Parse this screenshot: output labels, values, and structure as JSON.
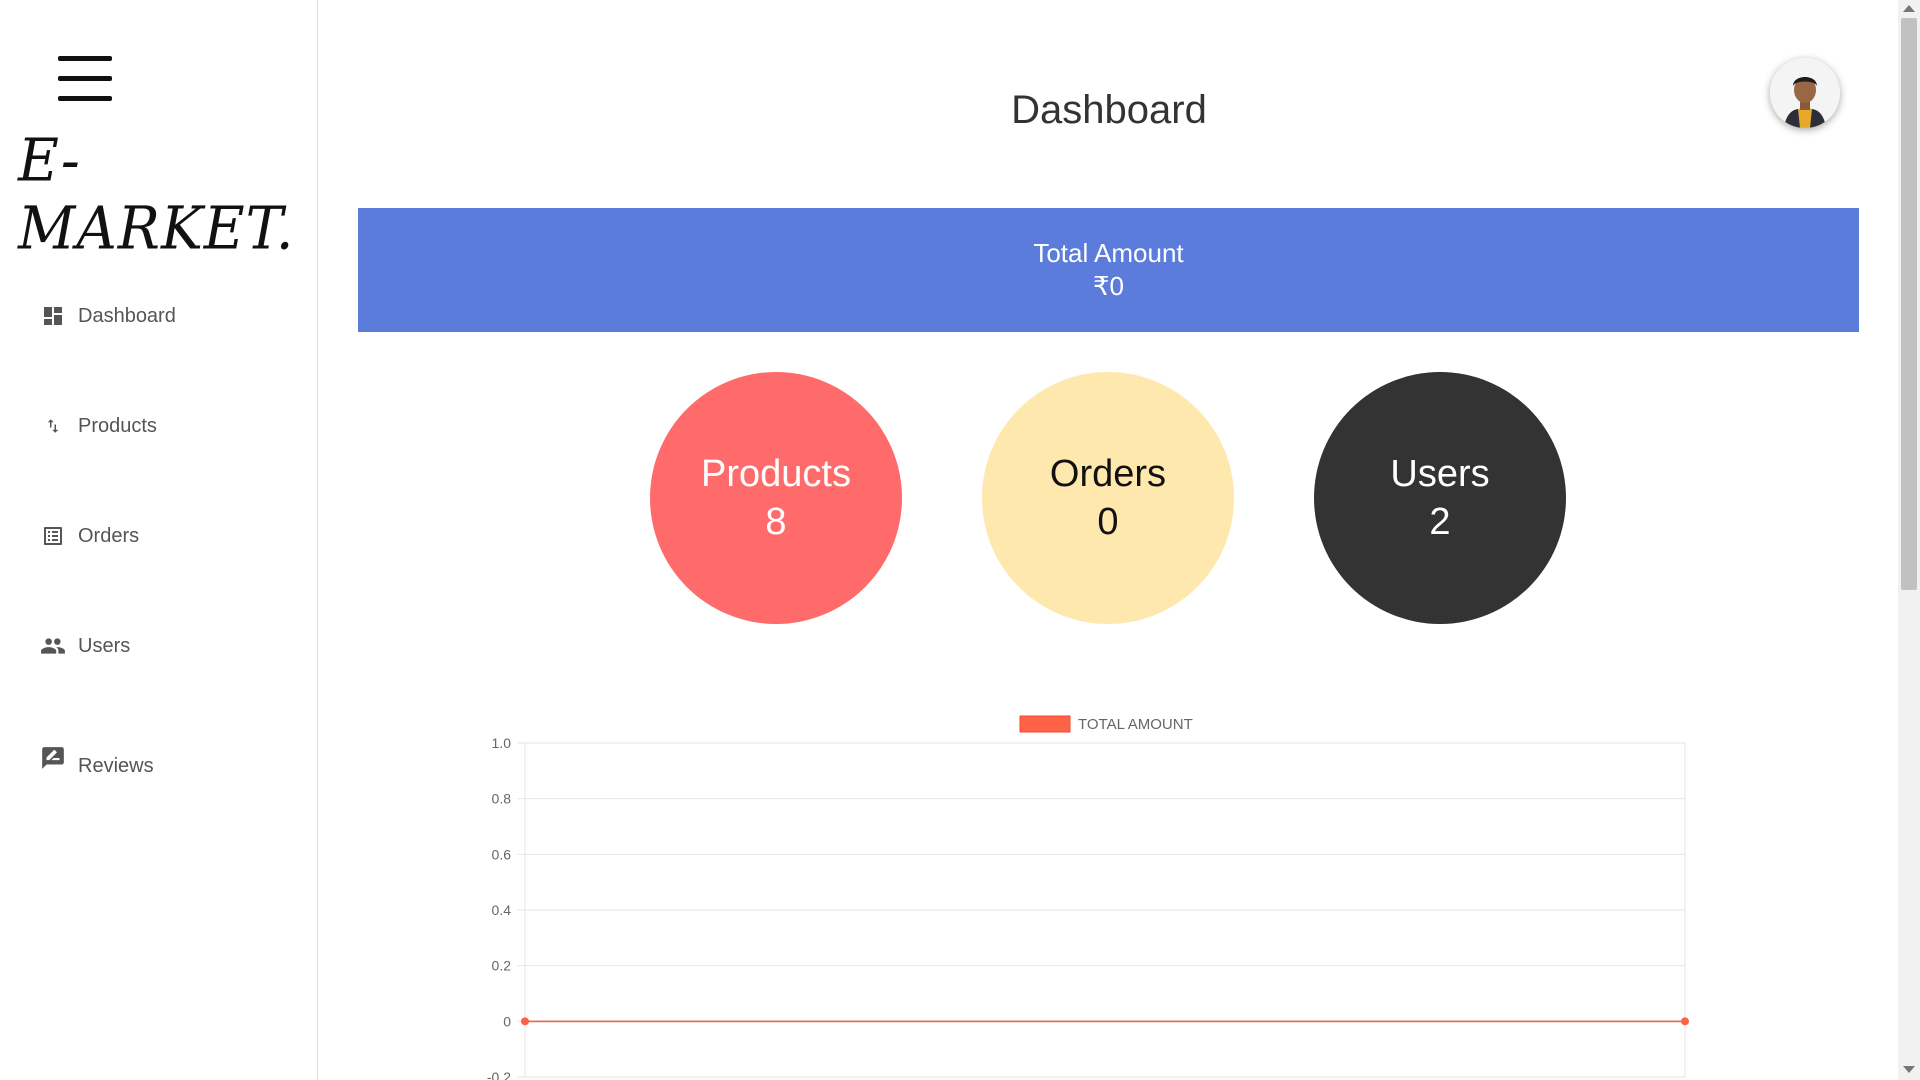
{
  "sidebar": {
    "logo": "E-MARKET.",
    "items": [
      {
        "label": "Dashboard",
        "icon": "dashboard-icon"
      },
      {
        "label": "Products",
        "icon": "swap-vert-icon"
      },
      {
        "label": "Orders",
        "icon": "list-alt-icon"
      },
      {
        "label": "Users",
        "icon": "people-icon"
      },
      {
        "label": "Reviews",
        "icon": "rate-review-icon"
      }
    ]
  },
  "header": {
    "title": "Dashboard"
  },
  "summary": {
    "total_label": "Total Amount",
    "total_value": "₹0"
  },
  "stats": [
    {
      "label": "Products",
      "value": "8",
      "color": "#ff6b6b"
    },
    {
      "label": "Orders",
      "value": "0",
      "color": "#ffe8ad"
    },
    {
      "label": "Users",
      "value": "2",
      "color": "#333333"
    }
  ],
  "colors": {
    "accent": "#5c7cdc",
    "chart_line": "#ff6347"
  },
  "chart_data": {
    "type": "line",
    "legend": [
      "TOTAL AMOUNT"
    ],
    "series": [
      {
        "name": "TOTAL AMOUNT",
        "values": [
          0,
          0
        ]
      }
    ],
    "x": [
      "",
      ""
    ],
    "ylim": [
      -0.2,
      1.0
    ],
    "yticks": [
      "1.0",
      "0.8",
      "0.6",
      "0.4",
      "0.2",
      "0",
      "-0.2"
    ],
    "grid": true,
    "legend_position": "top"
  }
}
